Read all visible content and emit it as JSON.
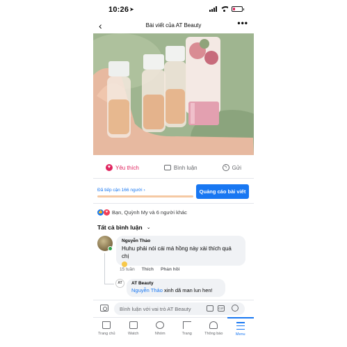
{
  "status": {
    "time": "10:26",
    "location_glyph": "➤"
  },
  "header": {
    "back": "‹",
    "title": "Bài viết của AT Beauty",
    "more": "•••"
  },
  "actions": {
    "like": "Yêu thích",
    "comment": "Bình luận",
    "send": "Gửi"
  },
  "reach": {
    "text": "Đã tiếp cận 166 người",
    "chevron": "›",
    "boost_button": "Quảng cáo bài viết"
  },
  "reactions": {
    "text": "Bạn, Quỳnh My và 6 người khác"
  },
  "comments_header": {
    "label": "Tất cả bình luận",
    "chevron": "⌄"
  },
  "comments": [
    {
      "author": "Nguyễn Thảo",
      "text": "Huhu phải nói cái má hồng này xài thích quá chị",
      "time": "15 tuần",
      "like": "Thích",
      "reply": "Phản hồi"
    }
  ],
  "reply": {
    "author": "AT Beauty",
    "mention": "Nguyễn Thảo",
    "text": " xinh dã man lun hen!",
    "avatar_text": "AT"
  },
  "input": {
    "placeholder": "Bình luận với vai trò AT Beauty",
    "gif": "GIF"
  },
  "nav": [
    {
      "label": "Trang chủ",
      "icon": "home-icon"
    },
    {
      "label": "Watch",
      "icon": "watch-icon"
    },
    {
      "label": "Nhóm",
      "icon": "groups-icon"
    },
    {
      "label": "Trang",
      "icon": "flag-icon"
    },
    {
      "label": "Thông báo",
      "icon": "bell-icon"
    },
    {
      "label": "Menu",
      "icon": "menu-icon",
      "active": true
    }
  ],
  "colors": {
    "accent": "#1877f2",
    "like": "#e0245e",
    "online": "#31a24c"
  }
}
